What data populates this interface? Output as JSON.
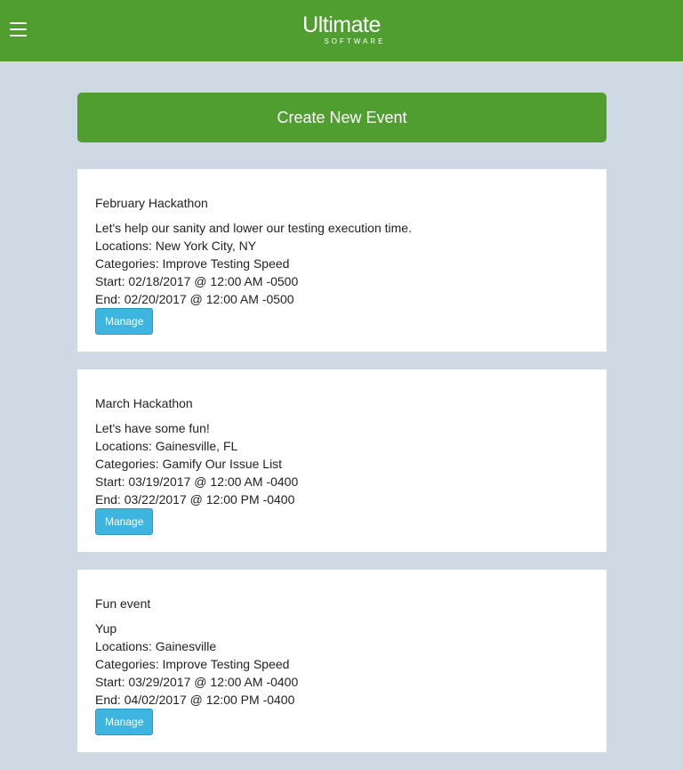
{
  "header": {
    "logo_main": "Ultimate",
    "logo_sub": "SOFTWARE"
  },
  "create_button_label": "Create New Event",
  "events": [
    {
      "title": "February Hackathon",
      "description": "Let's help our sanity and lower our testing execution time.",
      "locations": "Locations: New York City, NY",
      "categories": "Categories: Improve Testing Speed",
      "start": "Start: 02/18/2017 @ 12:00 AM -0500",
      "end": "End: 02/20/2017 @ 12:00 AM -0500",
      "manage_label": "Manage"
    },
    {
      "title": "March Hackathon",
      "description": "Let's have some fun!",
      "locations": "Locations: Gainesville, FL",
      "categories": "Categories: Gamify Our Issue List",
      "start": "Start: 03/19/2017 @ 12:00 AM -0400",
      "end": "End: 03/22/2017 @ 12:00 PM -0400",
      "manage_label": "Manage"
    },
    {
      "title": "Fun event",
      "description": "Yup",
      "locations": "Locations: Gainesville",
      "categories": "Categories: Improve Testing Speed",
      "start": "Start: 03/29/2017 @ 12:00 AM -0400",
      "end": "End: 04/02/2017 @ 12:00 PM -0400",
      "manage_label": "Manage"
    }
  ]
}
